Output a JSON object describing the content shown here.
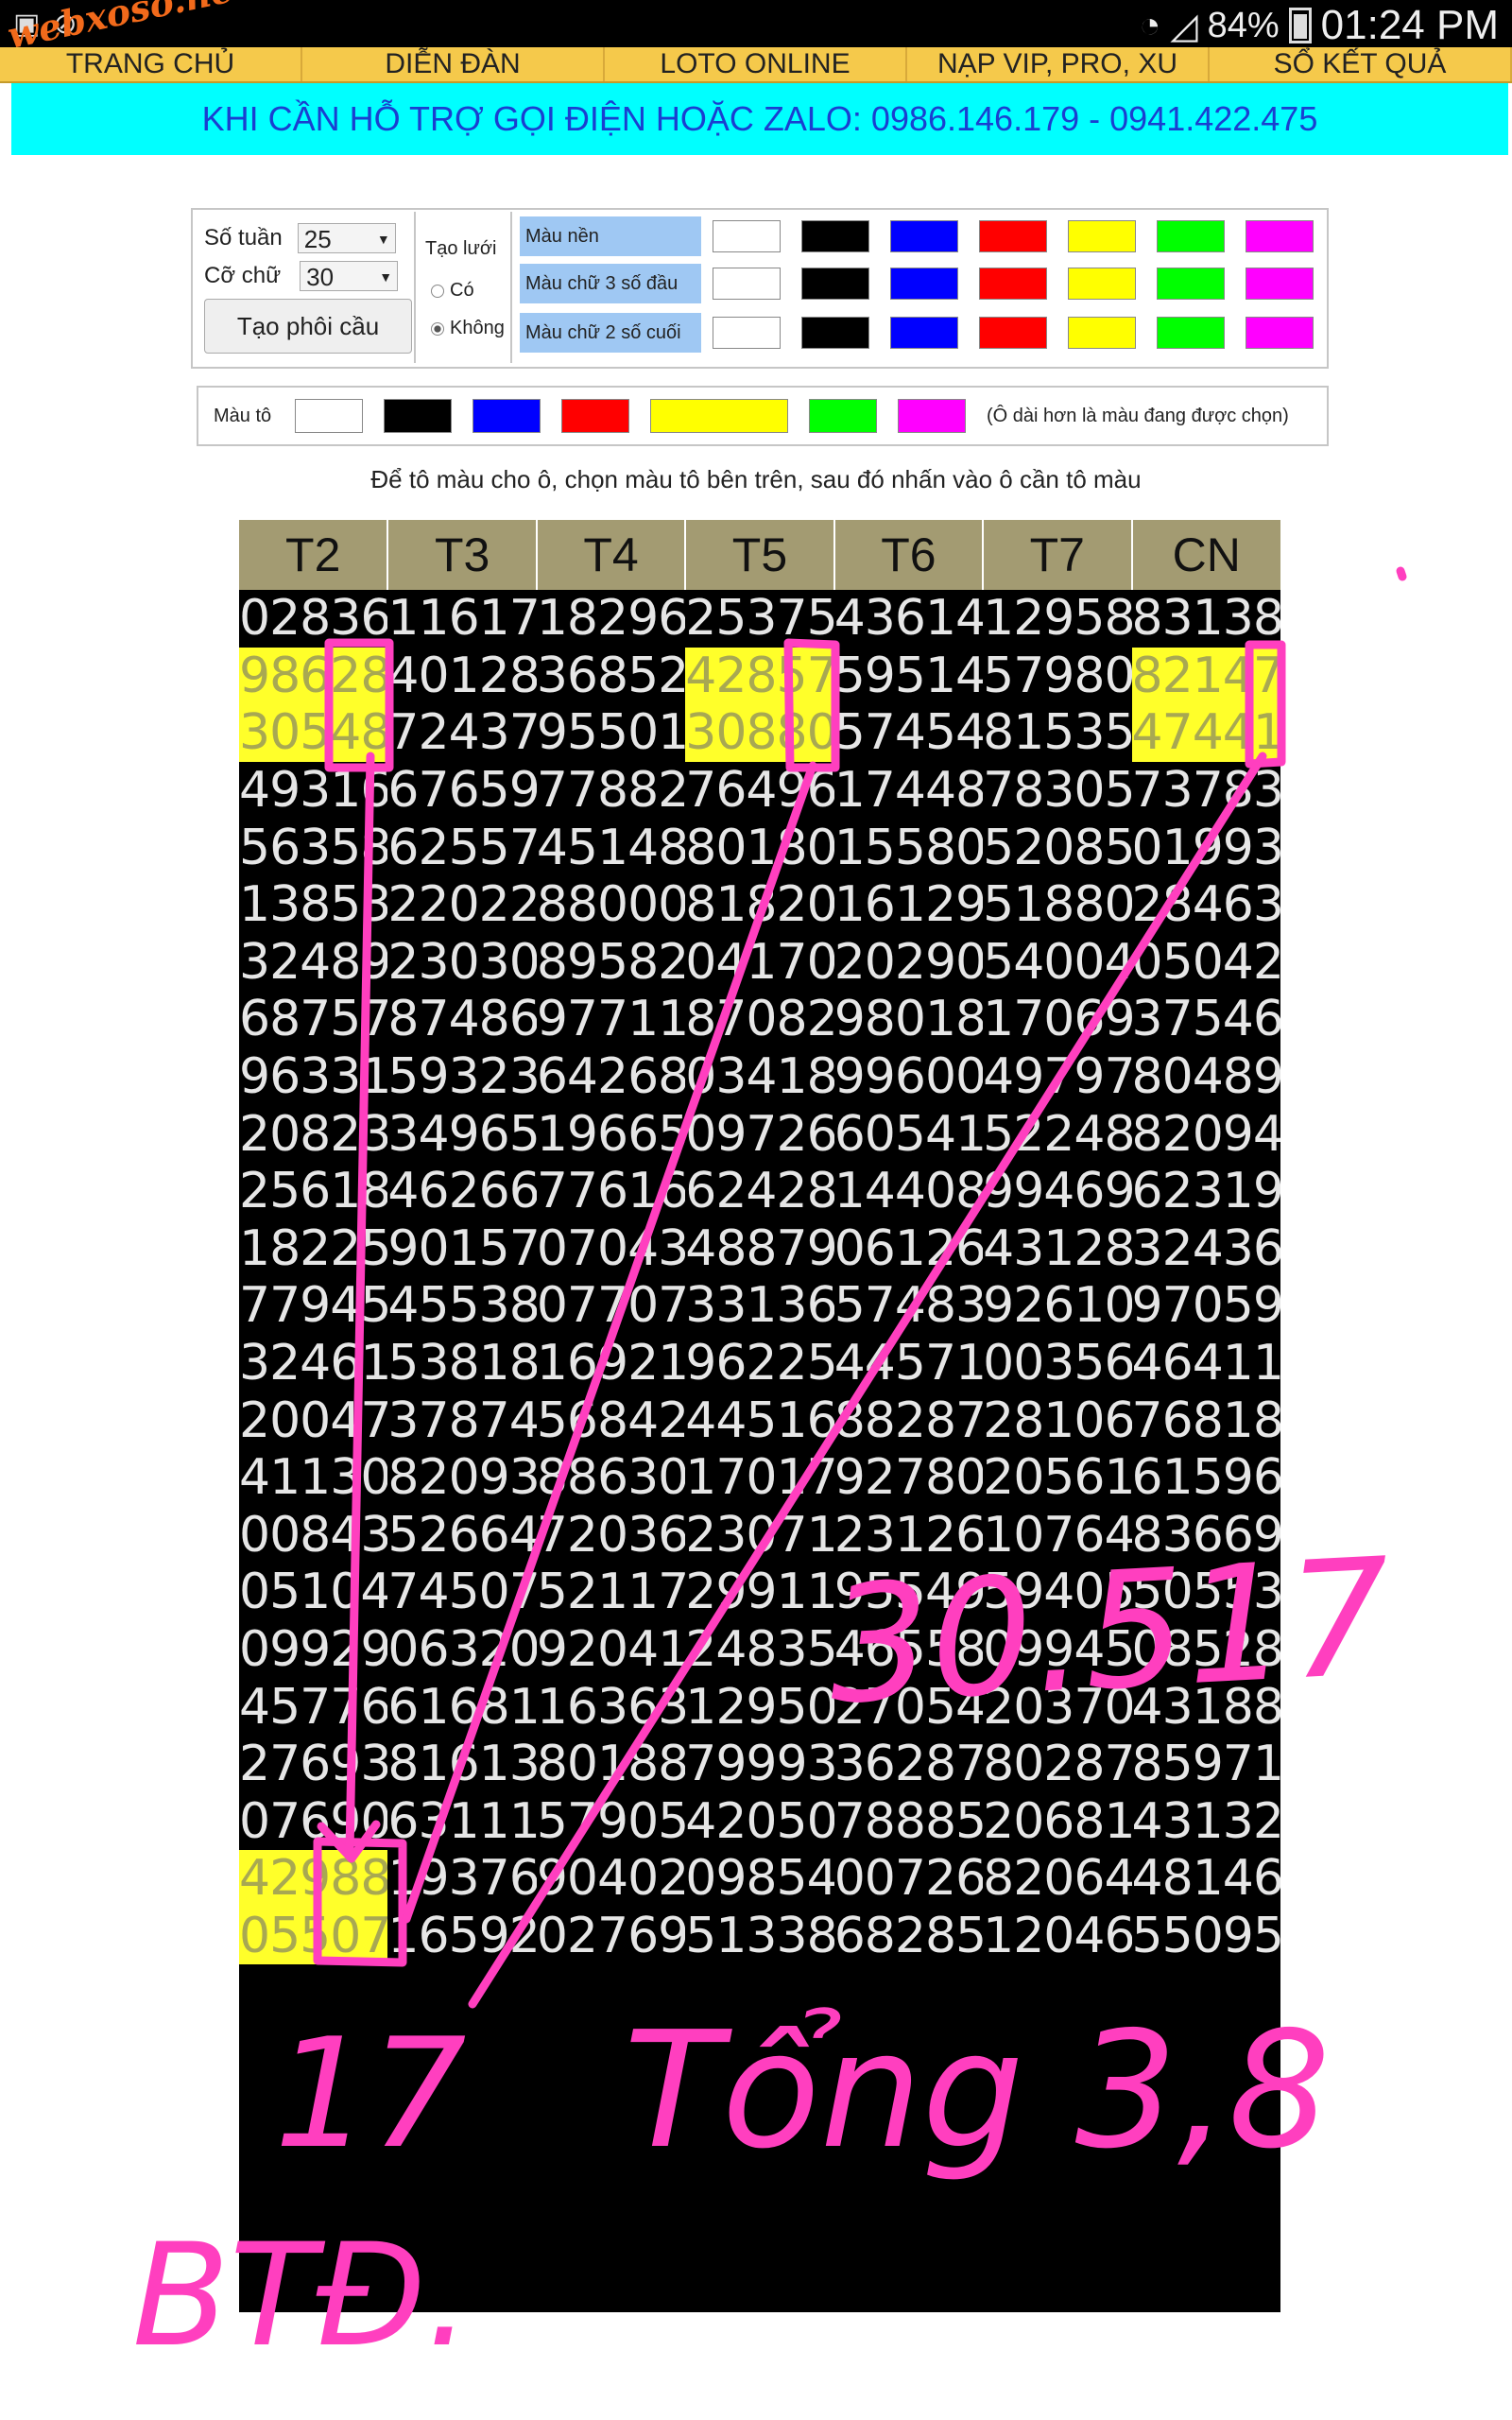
{
  "status_bar": {
    "battery": "84%",
    "time": "01:24 PM",
    "icons": [
      "sim-icon",
      "no-signal-icon",
      "wifi-icon",
      "battery-icon"
    ]
  },
  "watermark": "webxoso.net",
  "nav": {
    "items": [
      "TRANG CHỦ",
      "DIỄN ĐÀN",
      "LOTO ONLINE",
      "NẠP VIP, PRO, XU",
      "SỔ KẾT QUẢ"
    ]
  },
  "banner": "KHI CẦN HỖ TRỢ GỌI ĐIỆN HOẶC ZALO: 0986.146.179 - 0941.422.475",
  "controls": {
    "so_tuan_label": "Số tuần",
    "so_tuan_value": "25",
    "co_chu_label": "Cỡ chữ",
    "co_chu_value": "30",
    "build_button": "Tạo phôi cầu",
    "tao_luoi_label": "Tạo lưới",
    "radio_co": "Có",
    "radio_khong": "Không",
    "radio_selected": "Không",
    "color_rows": [
      "Màu nền",
      "Màu chữ 3 số đầu",
      "Màu chữ 2 số cuối"
    ],
    "swatches": [
      "#ffffff",
      "#000000",
      "#0000ff",
      "#ff0000",
      "#ffff00",
      "#00ff00",
      "#ff00ff"
    ]
  },
  "paint": {
    "label": "Màu tô",
    "swatches": [
      "#ffffff",
      "#000000",
      "#0000ff",
      "#ff0000",
      "#ffff00",
      "#00ff00",
      "#ff00ff"
    ],
    "selected": "#ffff00",
    "note": "(Ô dài hơn là màu đang được chọn)"
  },
  "instruction": "Để tô màu cho ô, chọn màu tô bên trên, sau đó nhấn vào ô cần tô màu",
  "grid": {
    "headers": [
      "T2",
      "T3",
      "T4",
      "T5",
      "T6",
      "T7",
      "CN"
    ],
    "rows": [
      [
        "02836",
        "11617",
        "18296",
        "25375",
        "43614",
        "12958",
        "83138"
      ],
      [
        "98628",
        "40128",
        "36852",
        "42857",
        "59514",
        "57980",
        "82147"
      ],
      [
        "30548",
        "72437",
        "95501",
        "30880",
        "57454",
        "81535",
        "47441"
      ],
      [
        "49316",
        "67659",
        "77882",
        "76496",
        "17448",
        "78305",
        "73783"
      ],
      [
        "56358",
        "62557",
        "45148",
        "80180",
        "15580",
        "52085",
        "01993"
      ],
      [
        "13853",
        "22022",
        "88000",
        "81820",
        "16129",
        "51880",
        "28463"
      ],
      [
        "32489",
        "23030",
        "89582",
        "04170",
        "20290",
        "54004",
        "05042"
      ],
      [
        "68757",
        "87486",
        "97711",
        "87082",
        "98018",
        "17069",
        "37546"
      ],
      [
        "96331",
        "59323",
        "64268",
        "03418",
        "99600",
        "49797",
        "80489"
      ],
      [
        "20823",
        "34965",
        "19665",
        "09726",
        "60541",
        "52248",
        "82094"
      ],
      [
        "25618",
        "46266",
        "77616",
        "62428",
        "14408",
        "99469",
        "62319"
      ],
      [
        "18225",
        "90157",
        "07043",
        "48879",
        "06126",
        "43128",
        "32436"
      ],
      [
        "77945",
        "45538",
        "07707",
        "33136",
        "57483",
        "92610",
        "97059"
      ],
      [
        "32461",
        "53818",
        "16921",
        "96225",
        "44571",
        "00356",
        "46411"
      ],
      [
        "20047",
        "37874",
        "56842",
        "44516",
        "88287",
        "28106",
        "76818"
      ],
      [
        "41130",
        "82093",
        "88630",
        "17017",
        "92780",
        "20561",
        "61596"
      ],
      [
        "00843",
        "52664",
        "72036",
        "23071",
        "23126",
        "10764",
        "83669"
      ],
      [
        "05104",
        "74507",
        "52117",
        "29911",
        "95549",
        "59405",
        "50553"
      ],
      [
        "09929",
        "06320",
        "92041",
        "24835",
        "46558",
        "09945",
        "08528"
      ],
      [
        "45776",
        "61681",
        "16363",
        "12950",
        "27054",
        "20370",
        "43188"
      ],
      [
        "27693",
        "81613",
        "80188",
        "79993",
        "36287",
        "80287",
        "85971"
      ],
      [
        "07690",
        "63111",
        "57905",
        "42050",
        "78885",
        "20681",
        "43132"
      ],
      [
        "42988",
        "19376",
        "90402",
        "09854",
        "00726",
        "82064",
        "48146"
      ],
      [
        "05507",
        "16592",
        "02769",
        "51338",
        "68285",
        "12046",
        "55095"
      ]
    ],
    "highlighted": [
      [
        1,
        0
      ],
      [
        2,
        0
      ],
      [
        1,
        3
      ],
      [
        2,
        3
      ],
      [
        1,
        6
      ],
      [
        2,
        6
      ],
      [
        22,
        0
      ],
      [
        23,
        0
      ]
    ]
  },
  "annotations": {
    "pen_color": "#ff3fbf",
    "texts": [
      "30.517",
      "17",
      "Tổng 3,8",
      "BTĐ."
    ]
  }
}
